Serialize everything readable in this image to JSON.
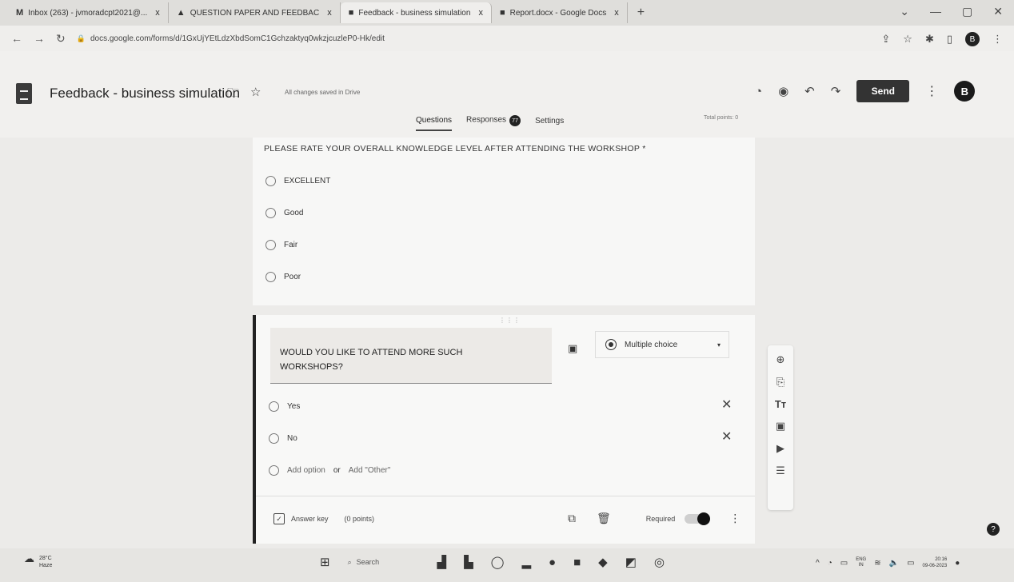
{
  "browser": {
    "tabs": [
      {
        "icon": "M",
        "title": "Inbox (263) - jvmoradcpt2021@...",
        "close": "x"
      },
      {
        "icon": "▲",
        "title": "QUESTION PAPER AND FEEDBAC",
        "close": "x"
      },
      {
        "icon": "■",
        "title": "Feedback - business simulation",
        "close": "x"
      },
      {
        "icon": "■",
        "title": "Report.docx - Google Docs",
        "close": "x"
      }
    ],
    "new_tab": "+",
    "window_controls": [
      "⌄",
      "—",
      "▢",
      "✕"
    ],
    "url": "docs.google.com/forms/d/1GxUjYEtLdzXbdSomC1Gchzaktyq0wkzjcuzleP0-Hk/edit",
    "profile_initial": "B"
  },
  "form": {
    "title": "Feedback - business simulation",
    "save_status": "All changes saved in Drive",
    "send_label": "Send",
    "avatar_initial": "B",
    "tabs": {
      "questions": "Questions",
      "responses": "Responses",
      "responses_count": "77",
      "settings": "Settings"
    },
    "total_points": "Total points: 0",
    "q1": {
      "title": "PLEASE RATE YOUR OVERALL KNOWLEDGE LEVEL AFTER  ATTENDING THE WORKSHOP *",
      "options": [
        "EXCELLENT",
        "Good",
        "Fair",
        "Poor"
      ]
    },
    "q2": {
      "title": "WOULD YOU LIKE TO ATTEND MORE SUCH WORKSHOPS?",
      "type": "Multiple choice",
      "options": [
        "Yes",
        "No"
      ],
      "add_option": "Add option",
      "or": "or",
      "add_other": "Add \"Other\"",
      "answer_key": "Answer key",
      "points": "(0 points)",
      "required": "Required"
    }
  },
  "taskbar": {
    "temp": "28°C",
    "condition": "Haze",
    "search": "Search",
    "lang": "ENG",
    "region": "IN",
    "time": "20:16",
    "date": "09-06-2023"
  }
}
